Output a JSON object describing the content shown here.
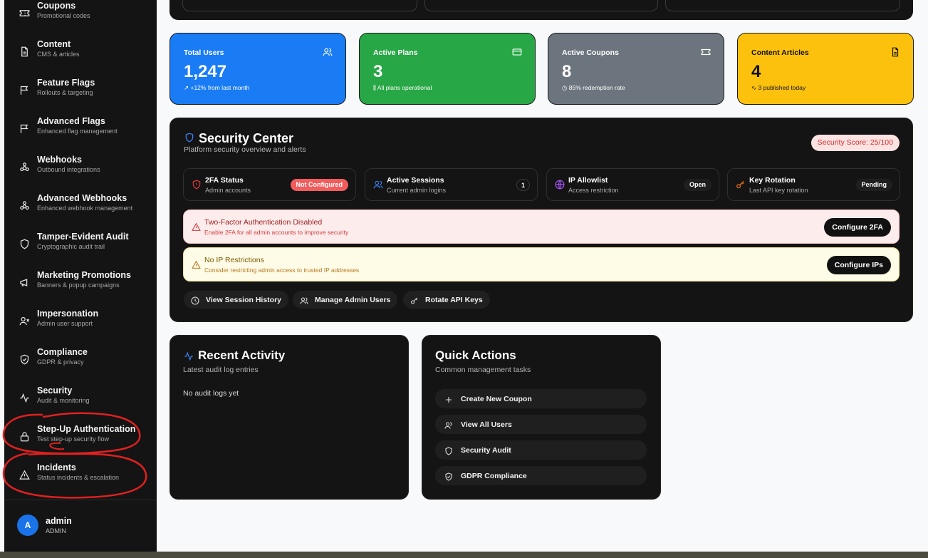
{
  "sidebar": {
    "items": [
      {
        "title": "Coupons",
        "sub": "Promotional codes",
        "icon": "ticket-icon"
      },
      {
        "title": "Content",
        "sub": "CMS & articles",
        "icon": "file-icon"
      },
      {
        "title": "Feature Flags",
        "sub": "Rollouts & targeting",
        "icon": "flag-icon"
      },
      {
        "title": "Advanced Flags",
        "sub": "Enhanced flag management",
        "icon": "flag-icon"
      },
      {
        "title": "Webhooks",
        "sub": "Outbound integrations",
        "icon": "webhook-icon"
      },
      {
        "title": "Advanced Webhooks",
        "sub": "Enhanced webhook management",
        "icon": "webhook-icon"
      },
      {
        "title": "Tamper-Evident Audit",
        "sub": "Cryptographic audit trail",
        "icon": "shield-icon"
      },
      {
        "title": "Marketing Promotions",
        "sub": "Banners & popup campaigns",
        "icon": "megaphone-icon"
      },
      {
        "title": "Impersonation",
        "sub": "Admin user support",
        "icon": "user-x-icon"
      },
      {
        "title": "Compliance",
        "sub": "GDPR & privacy",
        "icon": "shield-check-icon"
      },
      {
        "title": "Security",
        "sub": "Audit & monitoring",
        "icon": "activity-icon"
      },
      {
        "title": "Step-Up Authentication",
        "sub": "Test step-up security flow",
        "icon": "lock-icon"
      },
      {
        "title": "Incidents",
        "sub": "Status incidents & escalation",
        "icon": "alert-triangle-icon"
      }
    ],
    "user": {
      "initial": "A",
      "name": "admin",
      "role": "ADMIN"
    }
  },
  "stats": [
    {
      "label": "Total Users",
      "value": "1,247",
      "sub": "↗ +12% from last month",
      "bg": "#1a7cf5",
      "fg": "#ffffff",
      "icon": "users-icon"
    },
    {
      "label": "Active Plans",
      "value": "3",
      "sub": "⫼ All plans operational",
      "bg": "#27a745",
      "fg": "#ffffff",
      "icon": "credit-card-icon"
    },
    {
      "label": "Active Coupons",
      "value": "8",
      "sub": "◷ 85% redemption rate",
      "bg": "#6c757d",
      "fg": "#ffffff",
      "icon": "ticket-icon"
    },
    {
      "label": "Content Articles",
      "value": "4",
      "sub": "∿ 3 published today",
      "bg": "#fcc10d",
      "fg": "#111111",
      "icon": "file-icon"
    }
  ],
  "security": {
    "title": "Security Center",
    "subtitle": "Platform security overview and alerts",
    "score": "Security Score: 25/100",
    "cards": [
      {
        "title": "2FA Status",
        "sub": "Admin accounts",
        "badge": "Not Configured",
        "badge_bg": "#f25c5c",
        "badge_fg": "#ffffff",
        "icon": "shield-alert-icon",
        "icon_color": "#e53935"
      },
      {
        "title": "Active Sessions",
        "sub": "Current admin logins",
        "badge": "1",
        "badge_bg": "#141414",
        "badge_fg": "#ffffff",
        "icon": "users-icon",
        "icon_color": "#3b82f6"
      },
      {
        "title": "IP Allowlist",
        "sub": "Access restriction",
        "badge": "Open",
        "badge_bg": "#1f1f1f",
        "badge_fg": "#ffffff",
        "icon": "globe-icon",
        "icon_color": "#a855f7"
      },
      {
        "title": "Key Rotation",
        "sub": "Last API key rotation",
        "badge": "Pending",
        "badge_bg": "#1f1f1f",
        "badge_fg": "#ffffff",
        "icon": "key-icon",
        "icon_color": "#f97316"
      }
    ],
    "alerts": [
      {
        "title": "Two-Factor Authentication Disabled",
        "sub": "Enable 2FA for all admin accounts to improve security",
        "button": "Configure 2FA",
        "bg": "#fdecec",
        "border": "#f6c4c4",
        "fg": "#9b1c1c",
        "subfg": "#d33b3b"
      },
      {
        "title": "No IP Restrictions",
        "sub": "Consider restricting admin access to trusted IP addresses",
        "button": "Configure IPs",
        "bg": "#fefbe6",
        "border": "#f2e39b",
        "fg": "#7a5a00",
        "subfg": "#b7791f"
      }
    ],
    "actions": [
      {
        "label": "View Session History",
        "icon": "clock-icon"
      },
      {
        "label": "Manage Admin Users",
        "icon": "users-icon"
      },
      {
        "label": "Rotate API Keys",
        "icon": "key-icon"
      }
    ]
  },
  "recent": {
    "title": "Recent Activity",
    "subtitle": "Latest audit log entries",
    "empty": "No audit logs yet"
  },
  "quick": {
    "title": "Quick Actions",
    "subtitle": "Common management tasks",
    "items": [
      {
        "label": "Create New Coupon",
        "icon": "plus-icon"
      },
      {
        "label": "View All Users",
        "icon": "users-icon"
      },
      {
        "label": "Security Audit",
        "icon": "shield-icon"
      },
      {
        "label": "GDPR Compliance",
        "icon": "shield-check-icon"
      }
    ]
  }
}
